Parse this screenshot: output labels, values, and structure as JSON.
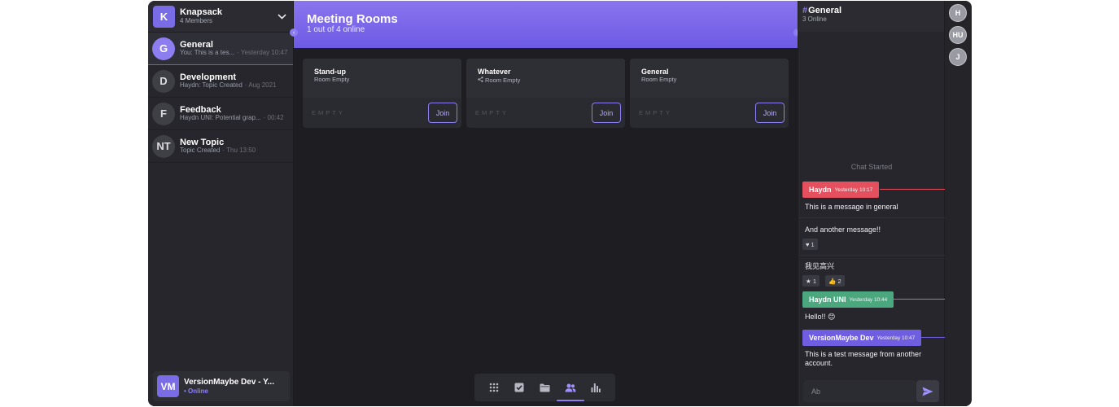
{
  "workspace": {
    "initial": "K",
    "name": "Knapsack",
    "members": "4 Members"
  },
  "topics": [
    {
      "initials": "G",
      "name": "General",
      "preview": "You: This is a tes...",
      "time": "· Yesterday 10:47"
    },
    {
      "initials": "D",
      "name": "Development",
      "preview": "Haydn: Topic Created",
      "time": "· Aug 2021"
    },
    {
      "initials": "F",
      "name": "Feedback",
      "preview": "Haydn UNI: Potential grap...",
      "time": "· 00:42"
    },
    {
      "initials": "NT",
      "name": "New Topic",
      "preview": "Topic Created",
      "time": "· Thu 13:50"
    }
  ],
  "current_user": {
    "initials": "VM",
    "name": "VersionMaybe Dev - Y...",
    "status": "• Online"
  },
  "main": {
    "title": "Meeting Rooms",
    "subtitle": "1 out of 4 online",
    "rooms": [
      {
        "name": "Stand-up",
        "status": "Room Empty",
        "empty_label": "EMPTY",
        "join_label": "Join"
      },
      {
        "name": "Whatever",
        "status": "Room Empty",
        "empty_label": "EMPTY",
        "join_label": "Join"
      },
      {
        "name": "General",
        "status": "Room Empty",
        "empty_label": "EMPTY",
        "join_label": "Join"
      }
    ],
    "toolbar": [
      "grid-icon",
      "checkbox-icon",
      "folder-icon",
      "people-icon",
      "chart-icon"
    ],
    "toolbar_active": "people-icon"
  },
  "chat": {
    "hash": "#",
    "title": "General",
    "online": "3 Online",
    "started": "Chat Started",
    "authors": [
      {
        "name": "Haydn",
        "time": "Yesterday 10:17",
        "color": "#e5505f"
      },
      {
        "name": "Haydn UNI",
        "time": "Yesterday 10:44",
        "color": "#4aa77e"
      },
      {
        "name": "VersionMaybe Dev",
        "time": "Yesterday 10:47",
        "color": "#6f5fe0"
      }
    ],
    "messages": [
      {
        "text": "This is a message in general"
      },
      {
        "text": "And another message!!",
        "reactions": [
          {
            "icon": "♥",
            "count": "1"
          }
        ]
      },
      {
        "text": "我见高兴",
        "reactions": [
          {
            "icon": "★",
            "count": "1"
          },
          {
            "icon": "👍",
            "count": "2"
          }
        ]
      },
      {
        "text": "Hello!! 😊"
      },
      {
        "text": "This is a test message from another account."
      }
    ],
    "input_placeholder": "Ab"
  },
  "members": [
    "H",
    "HU",
    "J"
  ]
}
